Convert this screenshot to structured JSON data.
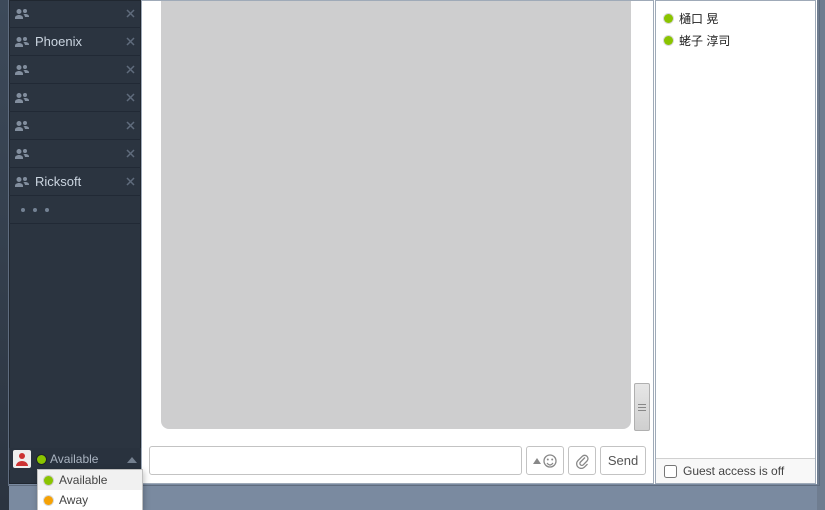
{
  "sidebar": {
    "rooms": [
      {
        "label": "",
        "has_close": true,
        "has_icon": true
      },
      {
        "label": "Phoenix",
        "has_close": true,
        "has_icon": true
      },
      {
        "label": "",
        "has_close": true,
        "has_icon": true
      },
      {
        "label": "",
        "has_close": true,
        "has_icon": true
      },
      {
        "label": "",
        "has_close": true,
        "has_icon": true
      },
      {
        "label": "",
        "has_close": true,
        "has_icon": true
      },
      {
        "label": "Ricksoft",
        "has_close": true,
        "has_icon": true
      },
      {
        "label": "",
        "has_close": false,
        "has_icon": false,
        "loading": true
      }
    ],
    "status": {
      "current_label": "Available",
      "current_color": "#8ac400",
      "options": [
        {
          "label": "Available",
          "color": "#8ac400",
          "selected": true
        },
        {
          "label": "Away",
          "color": "#f5a205",
          "selected": false
        }
      ]
    }
  },
  "chat": {
    "input_value": "",
    "send_label": "Send"
  },
  "people": {
    "list": [
      {
        "name": "樋口 晃",
        "color": "#8ac400"
      },
      {
        "name": "蛯子 淳司",
        "color": "#8ac400"
      }
    ],
    "guest_access_label": "Guest access is off",
    "guest_access_checked": false
  }
}
